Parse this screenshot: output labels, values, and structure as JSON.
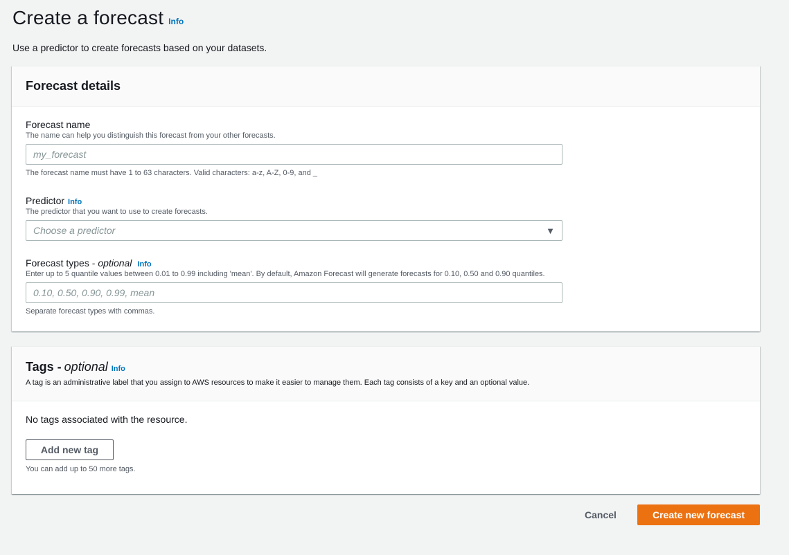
{
  "header": {
    "title": "Create a forecast",
    "info": "Info",
    "description": "Use a predictor to create forecasts based on your datasets."
  },
  "details": {
    "title": "Forecast details",
    "forecast_name": {
      "label": "Forecast name",
      "description": "The name can help you distinguish this forecast from your other forecasts.",
      "placeholder": "my_forecast",
      "value": "",
      "constraint": "The forecast name must have 1 to 63 characters. Valid characters: a-z, A-Z, 0-9, and _"
    },
    "predictor": {
      "label": "Predictor",
      "info": "Info",
      "description": "The predictor that you want to use to create forecasts.",
      "placeholder": "Choose a predictor",
      "icon": "caret-down-icon"
    },
    "forecast_types": {
      "label": "Forecast types -",
      "optional": "optional",
      "info": "Info",
      "description": "Enter up to 5 quantile values between 0.01 to 0.99 including 'mean'. By default, Amazon Forecast will generate forecasts for 0.10, 0.50 and 0.90 quantiles.",
      "placeholder": "0.10, 0.50, 0.90, 0.99, mean",
      "constraint": "Separate forecast types with commas."
    }
  },
  "tags": {
    "title": "Tags -",
    "optional": "optional",
    "info": "Info",
    "description": "A tag is an administrative label that you assign to AWS resources to make it easier to manage them. Each tag consists of a key and an optional value.",
    "empty_text": "No tags associated with the resource.",
    "add_button": "Add new tag",
    "limit_text": "You can add up to 50 more tags."
  },
  "footer": {
    "cancel": "Cancel",
    "submit": "Create new forecast"
  },
  "colors": {
    "primary": "#ec7211",
    "link": "#0073bb",
    "background": "#f2f3f3"
  }
}
